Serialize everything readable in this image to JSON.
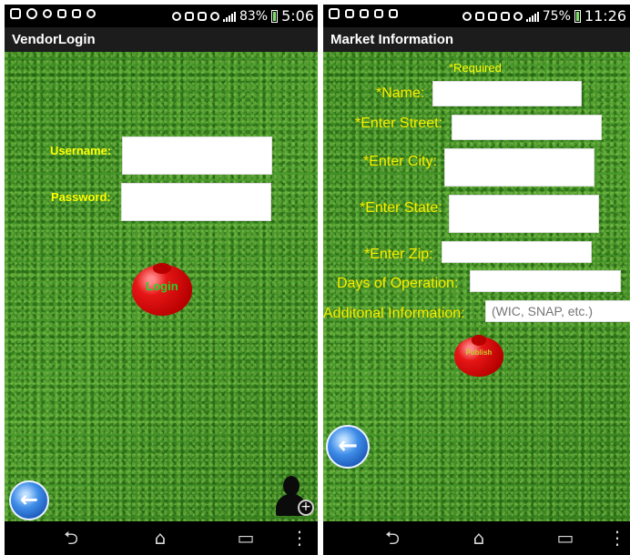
{
  "left_screen": {
    "status": {
      "battery": "83%",
      "time": "5:06"
    },
    "title": "VendorLogin",
    "username_label": "Username:",
    "username_value": "",
    "password_label": "Password:",
    "password_value": "",
    "login_label": "Login"
  },
  "right_screen": {
    "status": {
      "battery": "75%",
      "time": "11:26"
    },
    "title": "Market Information",
    "required_note": "*Required",
    "name_label": "*Name:",
    "street_label": "*Enter Street:",
    "city_label": "*Enter City:",
    "state_label": "*Enter State:",
    "zip_label": "*Enter Zip:",
    "days_label": "Days of Operation:",
    "additional_label": "Additonal Information:",
    "additional_placeholder": "(WIC, SNAP, etc.)",
    "publish_label": "Publish"
  },
  "nav": {
    "back_glyph": "⮌",
    "home_glyph": "⌂",
    "recent_glyph": "▭",
    "menu_glyph": "⋮"
  },
  "colors": {
    "label_yellow": "#ffff00",
    "apple_text_green": "#22d62a",
    "grass": "#3f8e24"
  }
}
